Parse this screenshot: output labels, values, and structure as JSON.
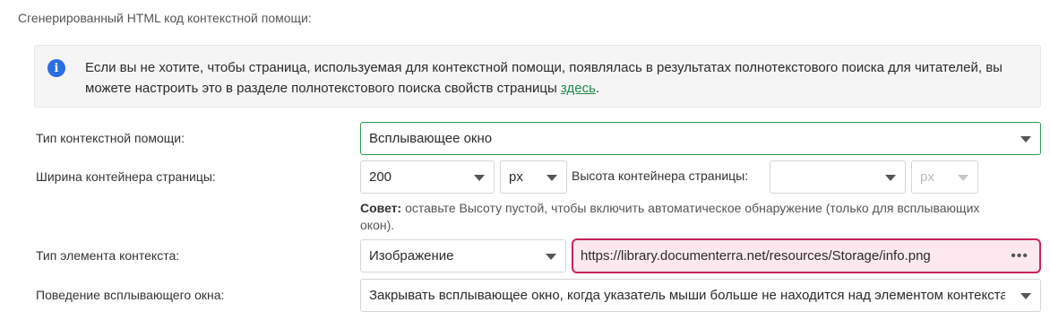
{
  "section_title": "Сгенерированный HTML код контекстной помощи:",
  "info": {
    "icon": "info-icon",
    "text": "Если вы не хотите, чтобы страница, используемая для контекстной помощи, появлялась в результатах полнотекстового поиска для читателей, вы можете настроить это в разделе полнотекстового поиска свойств страницы ",
    "link": "здесь",
    "after": "."
  },
  "form": {
    "help_type": {
      "label": "Тип контекстной помощи:",
      "value": "Всплывающее окно"
    },
    "width": {
      "label": "Ширина контейнера страницы:",
      "value": "200",
      "unit": "px"
    },
    "height": {
      "label": "Высота контейнера страницы:",
      "value": "",
      "unit": "px"
    },
    "hint": {
      "bold": "Совет:",
      "text": " оставьте Высоту пустой, чтобы включить автоматическое обнаружение (только для всплывающих окон)."
    },
    "element_type": {
      "label": "Тип элемента контекста:",
      "value": "Изображение",
      "url": "https://library.documenterra.net/resources/Storage/info.png",
      "more": "•••"
    },
    "popup_behavior": {
      "label": "Поведение всплывающего окна:",
      "value": "Закрывать всплывающее окно, когда указатель мыши больше не находится над элементом контекста"
    }
  },
  "colors": {
    "accent": "#2e9a52",
    "link": "#1e8a4b",
    "info_icon": "#2a6fe0",
    "url_border": "#c9245a",
    "url_bg": "#fde8ef"
  }
}
